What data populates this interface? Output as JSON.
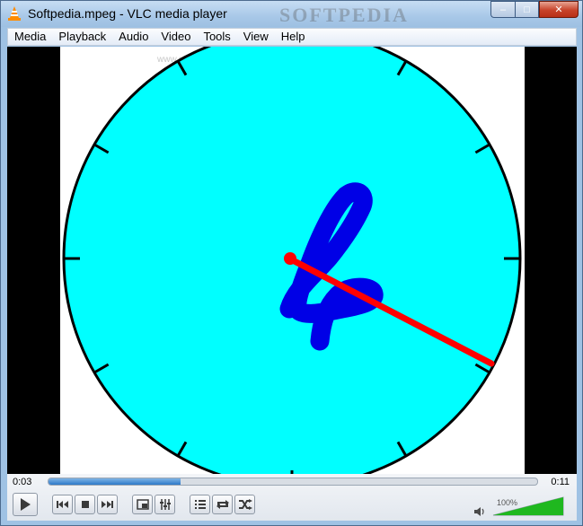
{
  "window": {
    "title": "Softpedia.mpeg - VLC media player",
    "watermark": "SOFTPEDIA",
    "buttons": {
      "minimize": "–",
      "maximize": "□",
      "close": "✕"
    }
  },
  "menu": {
    "items": [
      {
        "id": "media",
        "label": "Media"
      },
      {
        "id": "playback",
        "label": "Playback"
      },
      {
        "id": "audio",
        "label": "Audio"
      },
      {
        "id": "video",
        "label": "Video"
      },
      {
        "id": "tools",
        "label": "Tools"
      },
      {
        "id": "view",
        "label": "View"
      },
      {
        "id": "help",
        "label": "Help"
      }
    ]
  },
  "video": {
    "overlay_text": "www.softpedia.com",
    "clock": {
      "face_color": "#00ffff",
      "digit": "4",
      "digit_color": "#0000e6",
      "hand_color": "#ff0000"
    }
  },
  "controls": {
    "time_elapsed": "0:03",
    "time_total": "0:11",
    "progress": 0.27,
    "volume_label": "100%",
    "volume": 1.0,
    "accent_color": "#2c78c8",
    "volume_color": "#1fb81f",
    "icons": [
      "play-icon",
      "previous-icon",
      "stop-icon",
      "next-icon",
      "fullscreen-icon",
      "extended-settings-icon",
      "playlist-icon",
      "loop-icon",
      "shuffle-icon",
      "speaker-icon"
    ]
  }
}
